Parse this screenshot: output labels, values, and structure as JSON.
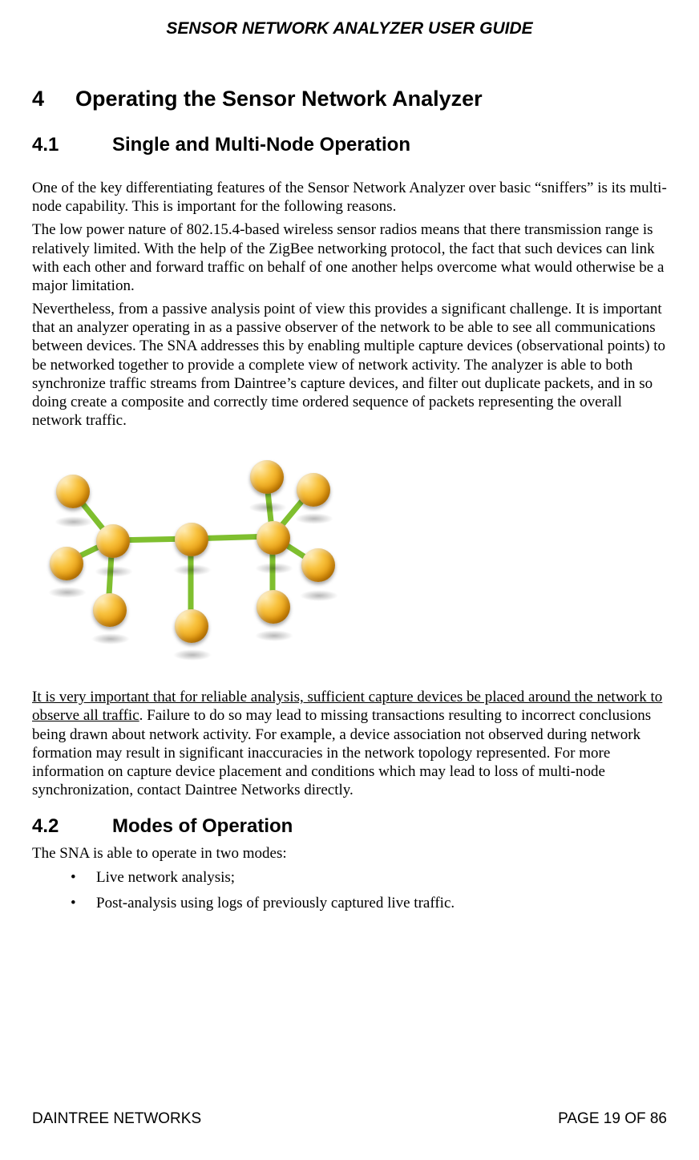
{
  "header": {
    "running_title": "SENSOR NETWORK ANALYZER USER GUIDE"
  },
  "chapter": {
    "number": "4",
    "title": "Operating the Sensor Network Analyzer"
  },
  "section_4_1": {
    "number": "4.1",
    "title": "Single and Multi-Node Operation",
    "p1": "One of the key differentiating features of the Sensor Network Analyzer over basic “sniffers” is its multi-node capability.  This is important for the following reasons.",
    "p2": "The low power nature of 802.15.4-based wireless sensor radios means that there transmission range is relatively limited.  With the help of the ZigBee networking protocol, the fact that such devices can link with each other and forward traffic on behalf of one another helps overcome what would otherwise be a major limitation.",
    "p3": "Nevertheless, from a passive analysis point of view this provides a significant challenge.  It is important that an analyzer operating in as a passive observer of the network to be able to see all communications between devices.  The SNA addresses this by enabling multiple capture devices (observational points) to be networked together to provide a complete view of network activity. The analyzer is able to both synchronize traffic streams from Daintree’s capture devices, and filter out duplicate packets, and in so doing create a composite and correctly time ordered sequence of packets representing the overall network traffic.",
    "p4_underlined": "It is very important that for reliable analysis, sufficient capture devices be placed around the network to observe all traffic",
    "p4_rest": ".  Failure to do so may lead to missing transactions resulting to incorrect conclusions being drawn about network activity.  For example, a device association not observed during network formation may result in significant inaccuracies in the network topology represented. For more information on capture device placement and conditions which may lead to loss of multi-node synchronization, contact Daintree Networks directly."
  },
  "section_4_2": {
    "number": "4.2",
    "title": "Modes of Operation",
    "intro": "The SNA is able to operate in two modes:",
    "bullets": {
      "b1": "Live network analysis;",
      "b2": "Post-analysis using logs of previously captured live traffic."
    }
  },
  "footer": {
    "left": "DAINTREE NETWORKS",
    "right": "PAGE 19 OF 86"
  }
}
